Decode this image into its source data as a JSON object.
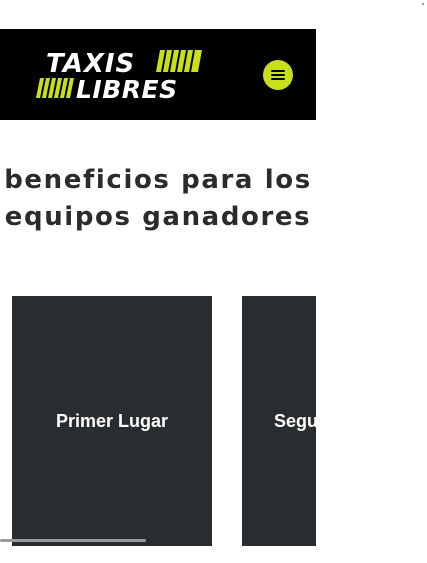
{
  "header": {
    "logo_text_top": "TAXIS",
    "logo_text_bottom": "LIBRES",
    "brand_color": "#c7e01a",
    "background_color": "#000000",
    "menu_icon": "hamburger-menu-icon"
  },
  "main": {
    "headline_line1": "beneficios para los",
    "headline_line2": "equipos ganadores",
    "cards": [
      {
        "label": "Primer Lugar",
        "background": "#2a2d2f"
      },
      {
        "label": "Segu",
        "background": "#2a2d2f"
      }
    ]
  }
}
